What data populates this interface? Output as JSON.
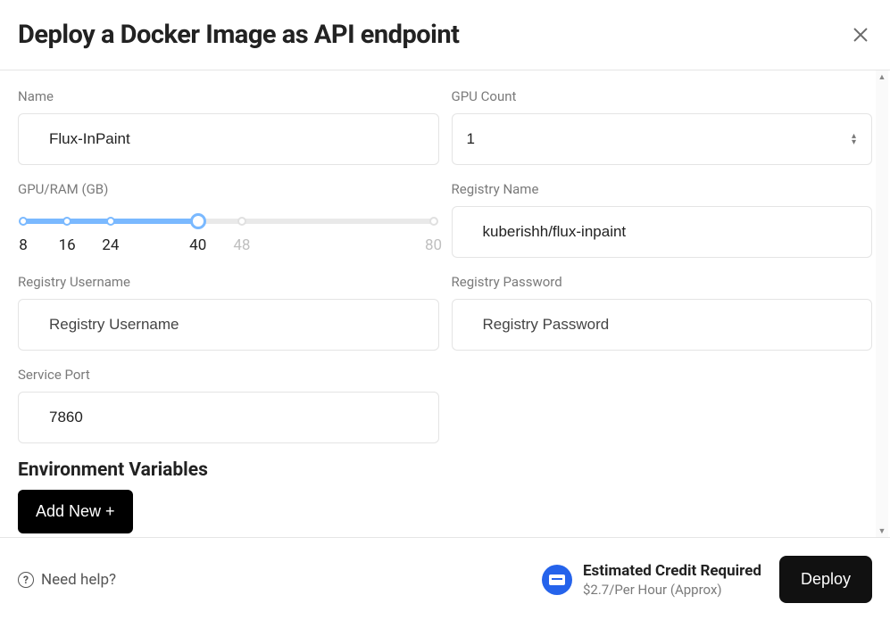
{
  "header": {
    "title": "Deploy a Docker Image as API endpoint"
  },
  "form": {
    "name": {
      "label": "Name",
      "value": "Flux-InPaint"
    },
    "gpu_count": {
      "label": "GPU Count",
      "value": "1"
    },
    "gpu_ram": {
      "label": "GPU/RAM (GB)",
      "ticks": [
        "8",
        "16",
        "24",
        "40",
        "48",
        "80"
      ],
      "value_index": 3,
      "positions_pct": [
        0,
        10.7,
        21.3,
        42.6,
        53.3,
        100
      ]
    },
    "registry_name": {
      "label": "Registry Name",
      "value": "kuberishh/flux-inpaint"
    },
    "registry_username": {
      "label": "Registry Username",
      "placeholder": "Registry Username",
      "value": ""
    },
    "registry_password": {
      "label": "Registry Password",
      "placeholder": "Registry Password",
      "value": ""
    },
    "service_port": {
      "label": "Service Port",
      "value": "7860"
    }
  },
  "env_section": {
    "title": "Environment Variables",
    "add_label": "Add New +"
  },
  "footer": {
    "help_label": "Need help?",
    "credit_title": "Estimated Credit Required",
    "credit_amount": "$2.7/Per Hour (Approx)",
    "deploy_label": "Deploy"
  },
  "colors": {
    "slider_active": "#7ab9ff",
    "primary_button": "#000000",
    "accent_blue": "#2563eb"
  }
}
